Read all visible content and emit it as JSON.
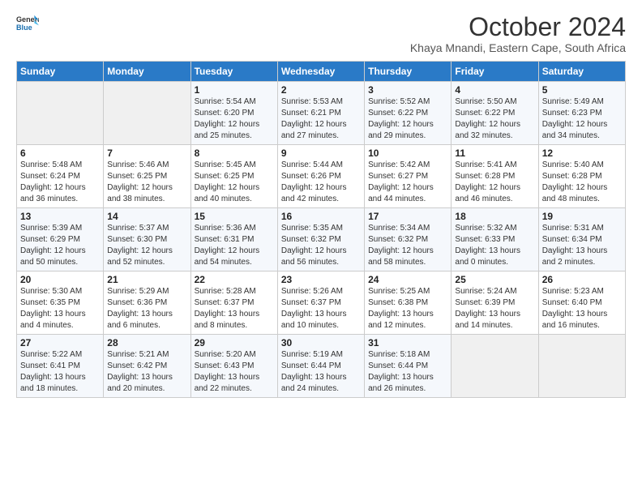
{
  "header": {
    "logo_line1": "General",
    "logo_line2": "Blue",
    "title": "October 2024",
    "subtitle": "Khaya Mnandi, Eastern Cape, South Africa"
  },
  "weekdays": [
    "Sunday",
    "Monday",
    "Tuesday",
    "Wednesday",
    "Thursday",
    "Friday",
    "Saturday"
  ],
  "weeks": [
    [
      {
        "day": "",
        "info": ""
      },
      {
        "day": "",
        "info": ""
      },
      {
        "day": "1",
        "info": "Sunrise: 5:54 AM\nSunset: 6:20 PM\nDaylight: 12 hours\nand 25 minutes."
      },
      {
        "day": "2",
        "info": "Sunrise: 5:53 AM\nSunset: 6:21 PM\nDaylight: 12 hours\nand 27 minutes."
      },
      {
        "day": "3",
        "info": "Sunrise: 5:52 AM\nSunset: 6:22 PM\nDaylight: 12 hours\nand 29 minutes."
      },
      {
        "day": "4",
        "info": "Sunrise: 5:50 AM\nSunset: 6:22 PM\nDaylight: 12 hours\nand 32 minutes."
      },
      {
        "day": "5",
        "info": "Sunrise: 5:49 AM\nSunset: 6:23 PM\nDaylight: 12 hours\nand 34 minutes."
      }
    ],
    [
      {
        "day": "6",
        "info": "Sunrise: 5:48 AM\nSunset: 6:24 PM\nDaylight: 12 hours\nand 36 minutes."
      },
      {
        "day": "7",
        "info": "Sunrise: 5:46 AM\nSunset: 6:25 PM\nDaylight: 12 hours\nand 38 minutes."
      },
      {
        "day": "8",
        "info": "Sunrise: 5:45 AM\nSunset: 6:25 PM\nDaylight: 12 hours\nand 40 minutes."
      },
      {
        "day": "9",
        "info": "Sunrise: 5:44 AM\nSunset: 6:26 PM\nDaylight: 12 hours\nand 42 minutes."
      },
      {
        "day": "10",
        "info": "Sunrise: 5:42 AM\nSunset: 6:27 PM\nDaylight: 12 hours\nand 44 minutes."
      },
      {
        "day": "11",
        "info": "Sunrise: 5:41 AM\nSunset: 6:28 PM\nDaylight: 12 hours\nand 46 minutes."
      },
      {
        "day": "12",
        "info": "Sunrise: 5:40 AM\nSunset: 6:28 PM\nDaylight: 12 hours\nand 48 minutes."
      }
    ],
    [
      {
        "day": "13",
        "info": "Sunrise: 5:39 AM\nSunset: 6:29 PM\nDaylight: 12 hours\nand 50 minutes."
      },
      {
        "day": "14",
        "info": "Sunrise: 5:37 AM\nSunset: 6:30 PM\nDaylight: 12 hours\nand 52 minutes."
      },
      {
        "day": "15",
        "info": "Sunrise: 5:36 AM\nSunset: 6:31 PM\nDaylight: 12 hours\nand 54 minutes."
      },
      {
        "day": "16",
        "info": "Sunrise: 5:35 AM\nSunset: 6:32 PM\nDaylight: 12 hours\nand 56 minutes."
      },
      {
        "day": "17",
        "info": "Sunrise: 5:34 AM\nSunset: 6:32 PM\nDaylight: 12 hours\nand 58 minutes."
      },
      {
        "day": "18",
        "info": "Sunrise: 5:32 AM\nSunset: 6:33 PM\nDaylight: 13 hours\nand 0 minutes."
      },
      {
        "day": "19",
        "info": "Sunrise: 5:31 AM\nSunset: 6:34 PM\nDaylight: 13 hours\nand 2 minutes."
      }
    ],
    [
      {
        "day": "20",
        "info": "Sunrise: 5:30 AM\nSunset: 6:35 PM\nDaylight: 13 hours\nand 4 minutes."
      },
      {
        "day": "21",
        "info": "Sunrise: 5:29 AM\nSunset: 6:36 PM\nDaylight: 13 hours\nand 6 minutes."
      },
      {
        "day": "22",
        "info": "Sunrise: 5:28 AM\nSunset: 6:37 PM\nDaylight: 13 hours\nand 8 minutes."
      },
      {
        "day": "23",
        "info": "Sunrise: 5:26 AM\nSunset: 6:37 PM\nDaylight: 13 hours\nand 10 minutes."
      },
      {
        "day": "24",
        "info": "Sunrise: 5:25 AM\nSunset: 6:38 PM\nDaylight: 13 hours\nand 12 minutes."
      },
      {
        "day": "25",
        "info": "Sunrise: 5:24 AM\nSunset: 6:39 PM\nDaylight: 13 hours\nand 14 minutes."
      },
      {
        "day": "26",
        "info": "Sunrise: 5:23 AM\nSunset: 6:40 PM\nDaylight: 13 hours\nand 16 minutes."
      }
    ],
    [
      {
        "day": "27",
        "info": "Sunrise: 5:22 AM\nSunset: 6:41 PM\nDaylight: 13 hours\nand 18 minutes."
      },
      {
        "day": "28",
        "info": "Sunrise: 5:21 AM\nSunset: 6:42 PM\nDaylight: 13 hours\nand 20 minutes."
      },
      {
        "day": "29",
        "info": "Sunrise: 5:20 AM\nSunset: 6:43 PM\nDaylight: 13 hours\nand 22 minutes."
      },
      {
        "day": "30",
        "info": "Sunrise: 5:19 AM\nSunset: 6:44 PM\nDaylight: 13 hours\nand 24 minutes."
      },
      {
        "day": "31",
        "info": "Sunrise: 5:18 AM\nSunset: 6:44 PM\nDaylight: 13 hours\nand 26 minutes."
      },
      {
        "day": "",
        "info": ""
      },
      {
        "day": "",
        "info": ""
      }
    ]
  ]
}
